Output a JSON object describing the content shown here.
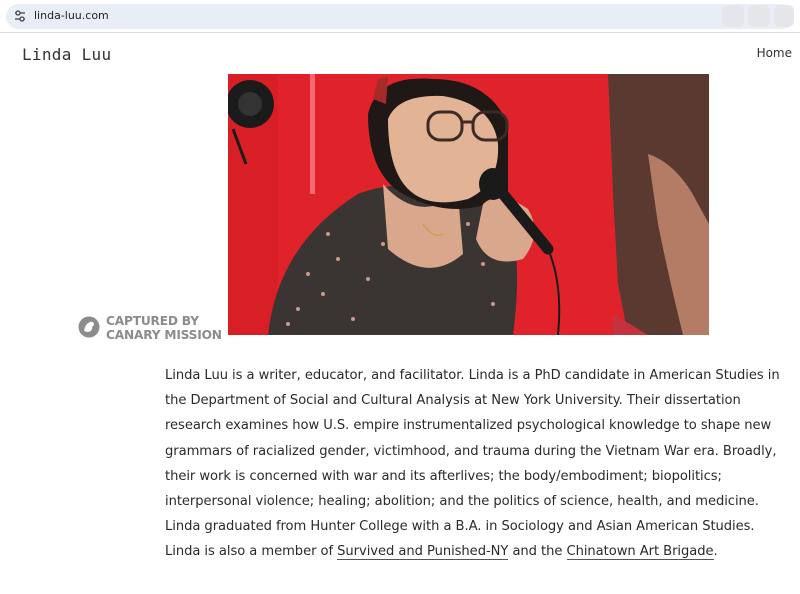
{
  "browser": {
    "url": "linda-luu.com"
  },
  "site": {
    "title": "Linda Luu",
    "nav": [
      {
        "label": "Home"
      }
    ]
  },
  "photo": {
    "description_icon": "portrait-photo",
    "background_color": "#e0232b"
  },
  "watermark": {
    "line1": "CAPTURED BY",
    "line2": "CANARY MISSION",
    "icon": "canary-logo-icon"
  },
  "bio": {
    "text_before_link1": "Linda Luu is a writer, educator, and facilitator. Linda is a PhD candidate in American Studies in the Department of Social and Cultural Analysis at New York University. Their dissertation research examines how U.S. empire instrumentalized psychological knowledge to shape new grammars of racialized gender, victimhood, and trauma during the Vietnam War era. Broadly, their work is concerned with war and its afterlives; the body/embodiment; biopolitics; interpersonal violence; healing; abolition; and the politics of science, health, and medicine. Linda graduated from Hunter College with a B.A. in Sociology and Asian American Studies. Linda is also a member of ",
    "link1": "Survived and Punished-NY",
    "text_between": " and the ",
    "link2": "Chinatown Art Brigade",
    "text_after": "."
  }
}
